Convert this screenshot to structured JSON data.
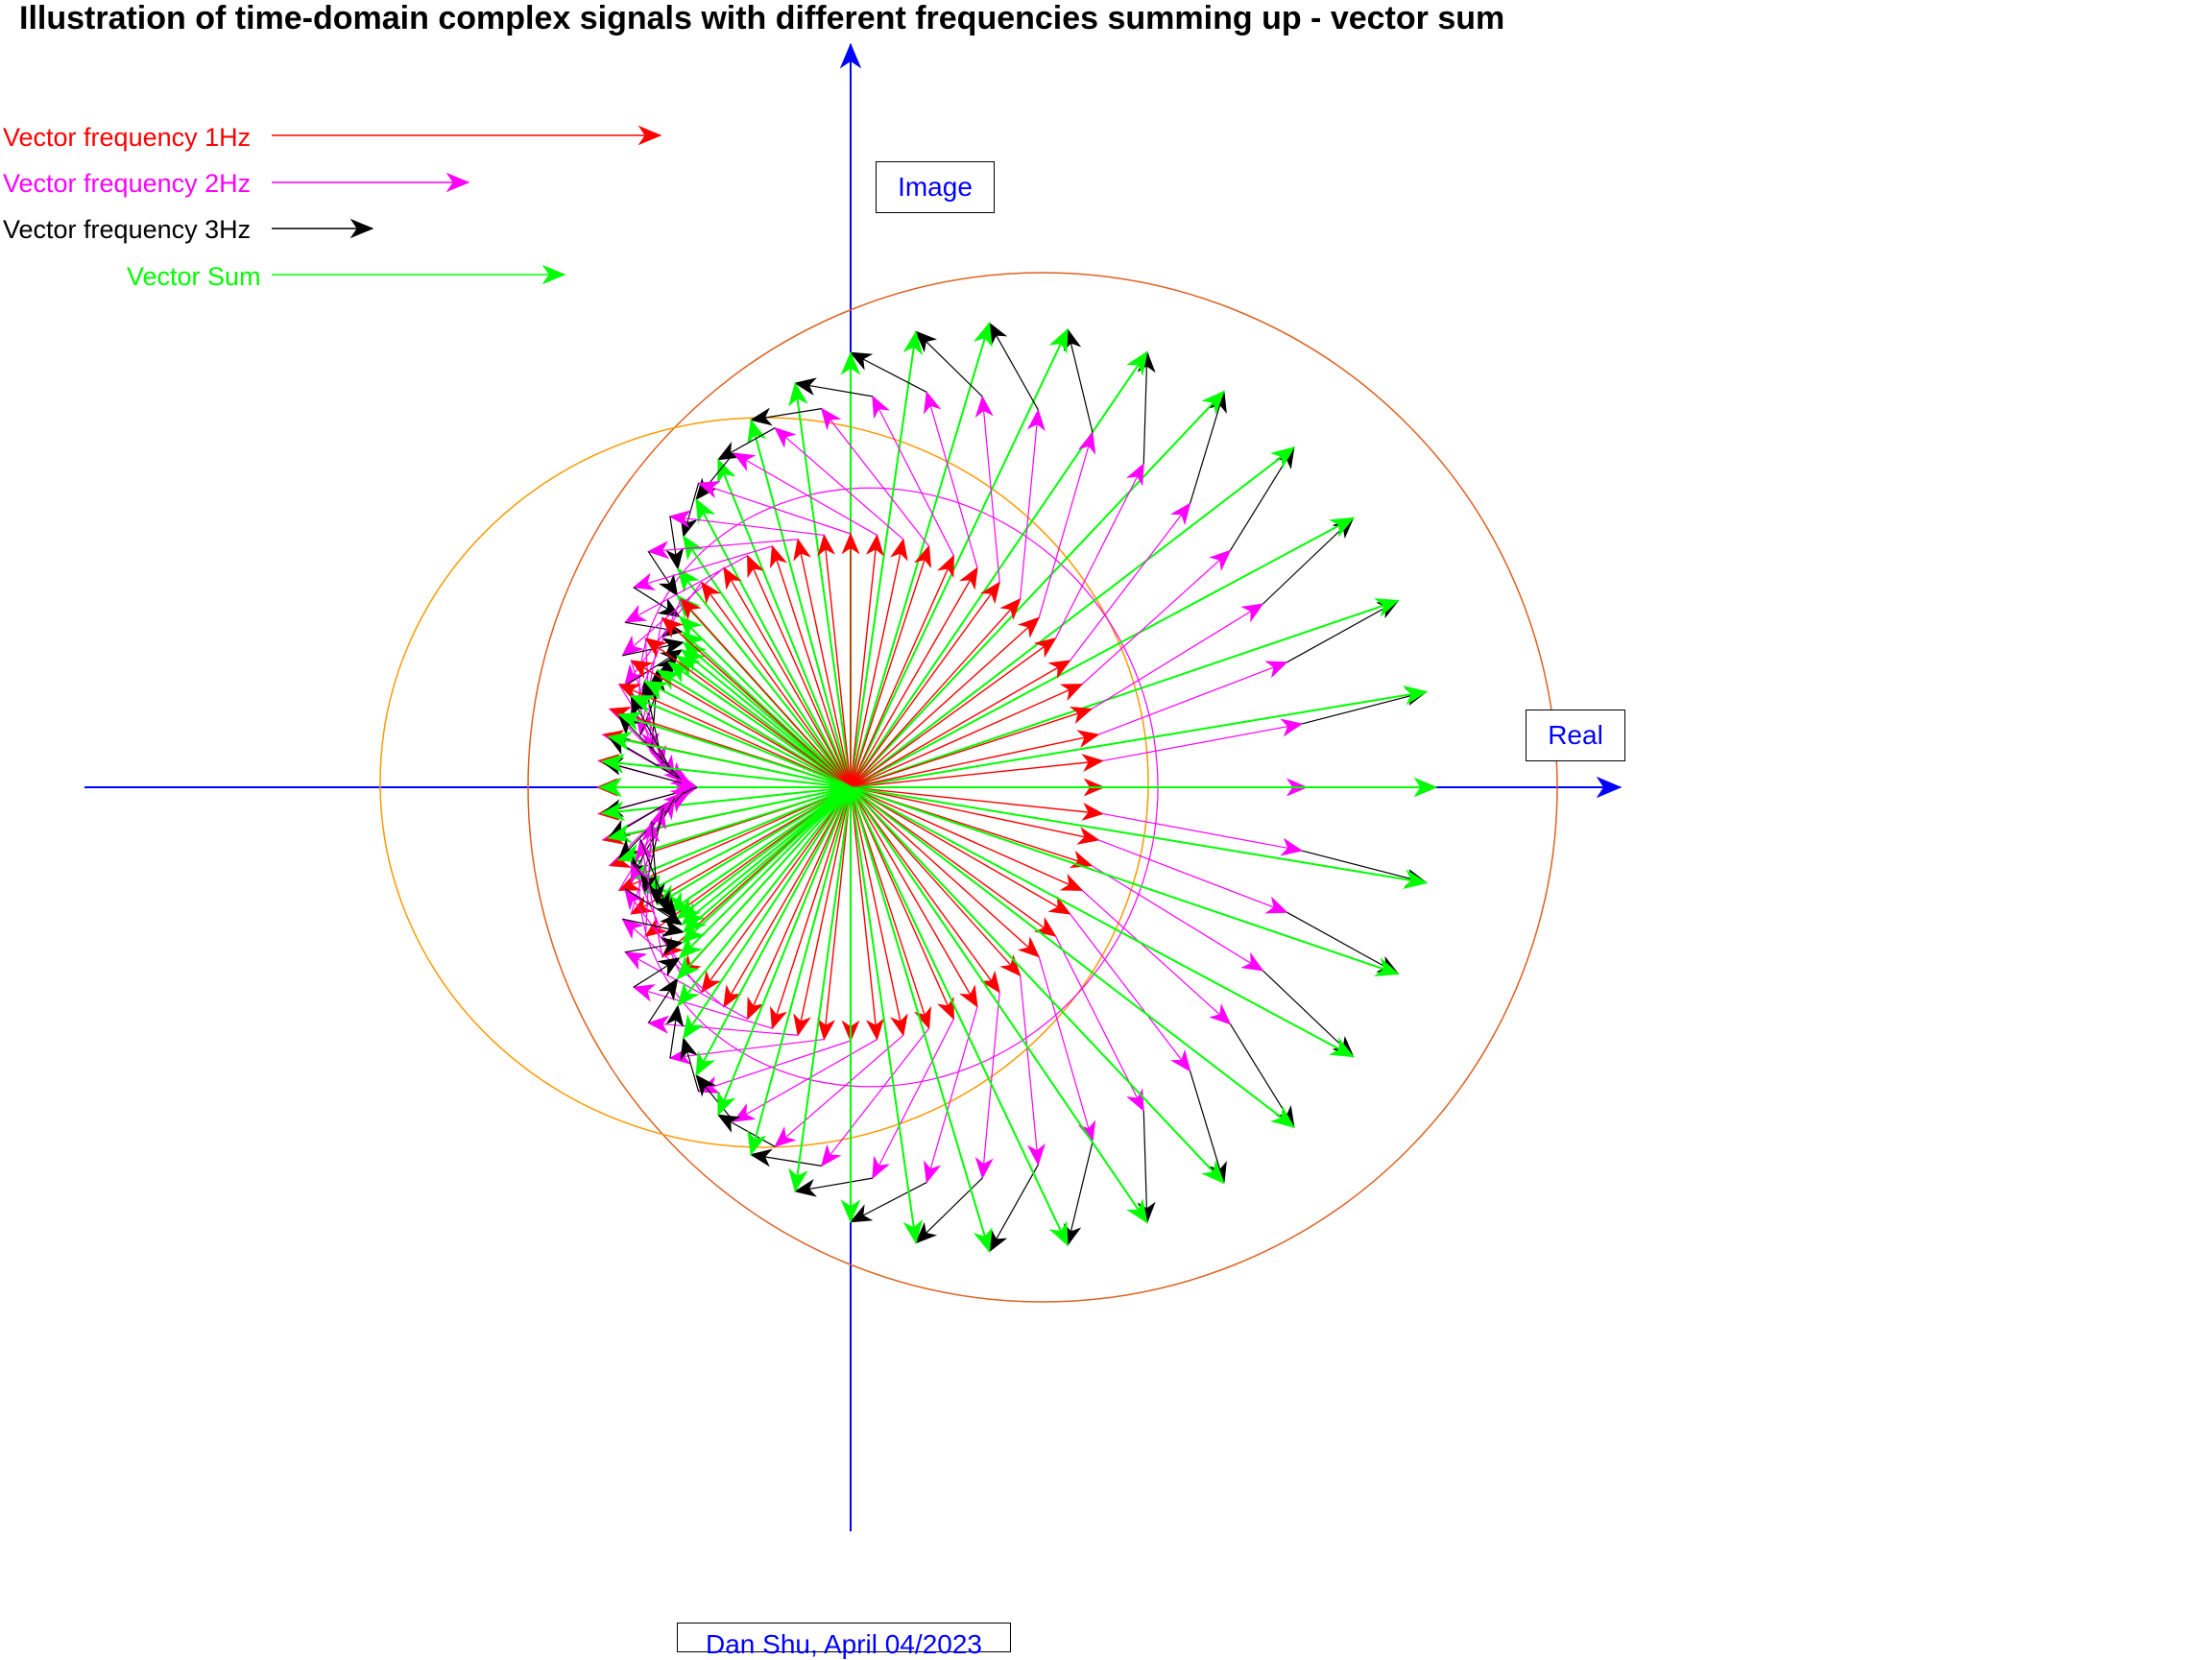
{
  "title": "Illustration of time-domain complex signals with different frequencies summing up - vector sum",
  "legend": [
    {
      "label": "Vector frequency 1Hz",
      "color": "#ff0000"
    },
    {
      "label": "Vector frequency 2Hz",
      "color": "#ff00ff"
    },
    {
      "label": "Vector frequency 3Hz",
      "color": "#000000"
    },
    {
      "label": "Vector Sum",
      "color": "#00ff00"
    }
  ],
  "axes": {
    "real_label": "Real",
    "image_label": "Image",
    "color": "#0000ff"
  },
  "footer": "Dan Shu, April 04/2023",
  "colors": {
    "circle": "#e06020",
    "ellipse": "#ff9900"
  },
  "chart_data": {
    "type": "phasor-diagram",
    "components": [
      {
        "frequency_hz": 1,
        "color": "#ff0000"
      },
      {
        "frequency_hz": 2,
        "color": "#ff00ff"
      },
      {
        "frequency_hz": 3,
        "color": "#000000"
      }
    ],
    "sum_color": "#00ff00"
  }
}
